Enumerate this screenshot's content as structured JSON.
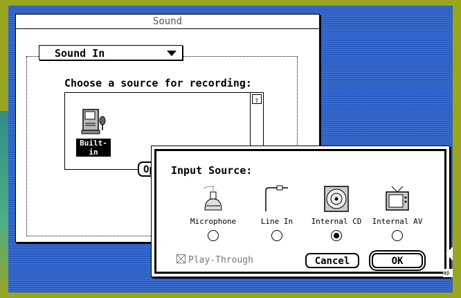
{
  "sound_window": {
    "title": "Sound",
    "popup_label": "Sound In",
    "prompt": "Choose a source for recording:",
    "sources": [
      {
        "label": "Built-in",
        "icon": "microphone-computer-icon",
        "selected": true
      }
    ],
    "options_button_label": "Options..."
  },
  "input_dialog": {
    "title": "Input Source:",
    "sources": [
      {
        "label": "Microphone",
        "icon": "microphone-icon",
        "selected": false
      },
      {
        "label": "Line In",
        "icon": "line-in-jack-icon",
        "selected": false
      },
      {
        "label": "Internal CD",
        "icon": "cd-icon",
        "selected": true
      },
      {
        "label": "Internal AV",
        "icon": "tv-icon",
        "selected": false
      }
    ],
    "playthrough_label": "Play-Through",
    "playthrough_enabled": false,
    "cancel_label": "Cancel",
    "ok_label": "OK"
  },
  "desktop": {
    "partial_label": "ap",
    "background_color": "#2b5fc6",
    "frame_color": "#9aa51f"
  }
}
